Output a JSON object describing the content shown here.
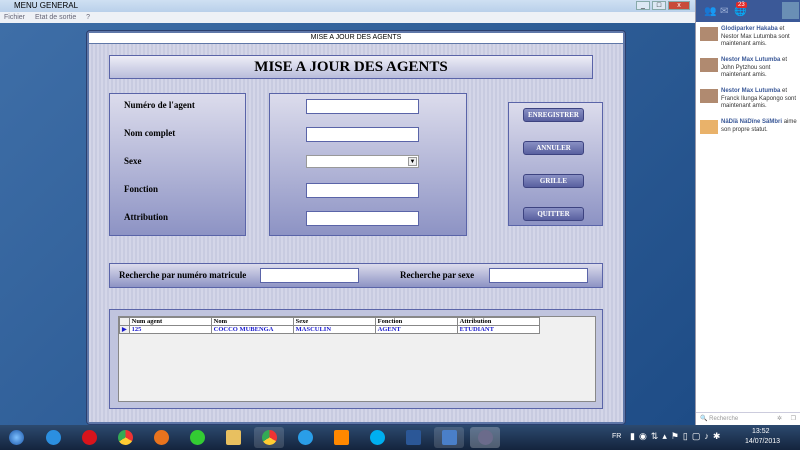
{
  "app": {
    "title": "MENU GENERAL",
    "menu": [
      "Fichier",
      "Etat de sortie",
      "?"
    ]
  },
  "dialog": {
    "window_title": "MISE A JOUR DES AGENTS",
    "heading": "MISE A JOUR DES AGENTS",
    "labels": [
      "Numéro de l'agent",
      "Nom complet",
      "Sexe",
      "Fonction",
      "Attribution"
    ],
    "fields": {
      "numero": "",
      "nom": "",
      "sexe": "",
      "fonction": "",
      "attribution": ""
    },
    "buttons": {
      "save": "ENREGISTRER",
      "cancel": "ANNULER",
      "grid": "GRILLE",
      "quit": "QUITTER"
    },
    "search": {
      "matricule_label": "Recherche par numéro matricule",
      "matricule_value": "",
      "sexe_label": "Recherche par sexe",
      "sexe_value": ""
    },
    "grid": {
      "columns": [
        "Num agent",
        "Nom",
        "Sexe",
        "Fonction",
        "Attribution"
      ],
      "rows": [
        [
          "125",
          "COCCO MUBENGA",
          "MASCULIN",
          "AGENT",
          "ETUDIANT"
        ]
      ]
    }
  },
  "facebook": {
    "notif_count": "23",
    "items": [
      {
        "name": "Glodiparker Hakaba",
        "text": "et Nestor Max Lutumba sont maintenant amis."
      },
      {
        "name": "Nestor Max Lutumba",
        "text": "et John Pytzhou sont maintenant amis."
      },
      {
        "name": "Nestor Max Lutumba",
        "text": "et Franck Ilunga Kapongo sont maintenant amis."
      },
      {
        "name": "NäDïä NäDïne SäMbri",
        "text": "aime son propre statut."
      }
    ],
    "search_placeholder": "Recherche"
  },
  "taskbar": {
    "lang": "FR",
    "time": "13:52",
    "date": "14/07/2013"
  }
}
